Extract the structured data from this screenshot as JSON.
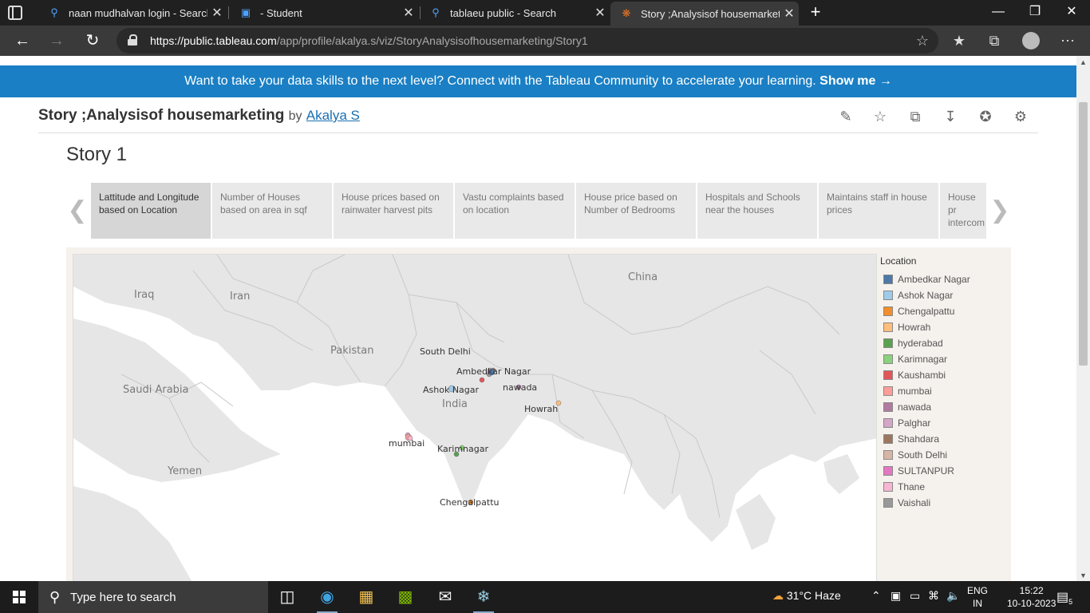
{
  "browser": {
    "tabs": [
      {
        "title": "naan mudhalvan login - Search",
        "icon": "search-icon"
      },
      {
        "title": "- Student",
        "icon": "app-icon"
      },
      {
        "title": "tablaeu public - Search",
        "icon": "search-icon"
      },
      {
        "title": "Story ;Analysisof housemarketing",
        "icon": "tableau-icon",
        "active": true
      }
    ],
    "url_host": "https://public.tableau.com",
    "url_path": "/app/profile/akalya.s/viz/StoryAnalysisofhousemarketing/Story1"
  },
  "banner": {
    "text": "Want to take your data skills to the next level? Connect with the Tableau Community to accelerate your learning.",
    "cta": "Show me →"
  },
  "viz": {
    "title": "Story ;Analysisof housemarketing",
    "by": "by",
    "author": "Akalya S"
  },
  "story": {
    "title": "Story 1",
    "points": [
      "Lattitude and Longitude based on Location",
      "Number of Houses based on area in sqf",
      "House prices based on rainwater harvest pits",
      "Vastu complaints based on location",
      "House price based on Number of Bedrooms",
      "Hospitals and Schools near the houses",
      "Maintains staff in house prices",
      "House pr intercom"
    ],
    "active_point": 0
  },
  "map": {
    "region_labels": [
      "China",
      "Iraq",
      "Iran",
      "Pakistan",
      "Saudi Arabia",
      "India",
      "Yemen"
    ],
    "place_labels": [
      "South Delhi",
      "Ambedkar Nagar",
      "Ashok Nagar",
      "nawada",
      "Howrah",
      "mumbai",
      "Karimnagar",
      "Chengalpattu"
    ]
  },
  "legend": {
    "title": "Location",
    "items": [
      {
        "label": "Ambedkar Nagar",
        "color": "#4e79a7"
      },
      {
        "label": "Ashok Nagar",
        "color": "#a0cbe8"
      },
      {
        "label": "Chengalpattu",
        "color": "#f28e2b"
      },
      {
        "label": "Howrah",
        "color": "#ffbe7d"
      },
      {
        "label": "hyderabad",
        "color": "#59a14f"
      },
      {
        "label": "Karimnagar",
        "color": "#8cd17d"
      },
      {
        "label": "Kaushambi",
        "color": "#e15759"
      },
      {
        "label": "mumbai",
        "color": "#ff9d9a"
      },
      {
        "label": "nawada",
        "color": "#b07aa1"
      },
      {
        "label": "Palghar",
        "color": "#d4a6c8"
      },
      {
        "label": "Shahdara",
        "color": "#9d7660"
      },
      {
        "label": "South Delhi",
        "color": "#d7b5a6"
      },
      {
        "label": "SULTANPUR",
        "color": "#e377c2"
      },
      {
        "label": "Thane",
        "color": "#f7b6d2"
      },
      {
        "label": "Vaishali",
        "color": "#999999"
      }
    ]
  },
  "taskbar": {
    "search_placeholder": "Type here to search",
    "weather": "31°C  Haze",
    "lang_line1": "ENG",
    "lang_line2": "IN",
    "time": "15:22",
    "date": "10-10-2023",
    "notifications": "5"
  }
}
